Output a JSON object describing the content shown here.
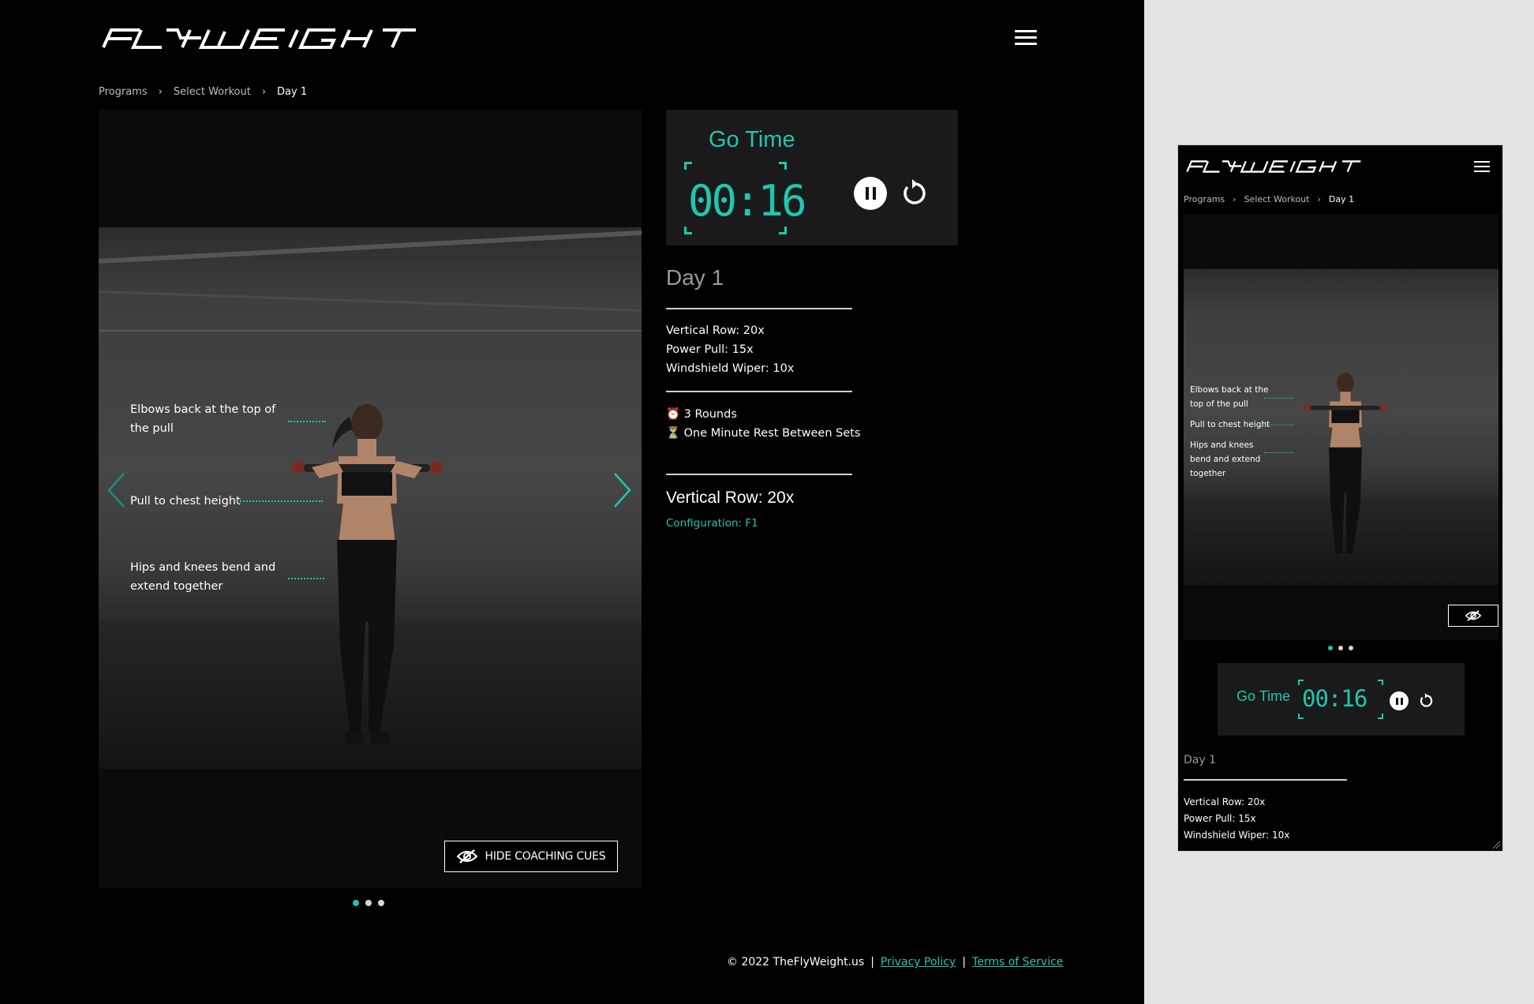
{
  "brand": {
    "logo_text": "FLYWEIGHT",
    "accent_color": "#20c6b0"
  },
  "breadcrumb": [
    "Programs",
    "Select Workout",
    "Day 1"
  ],
  "media": {
    "coaching_cues": [
      "Elbows back at the top of the pull",
      "Pull to chest height",
      "Hips and knees bend and extend together"
    ],
    "hide_cues_label": "HIDE COACHING CUES",
    "slide_count": 3,
    "active_slide": 1
  },
  "timer": {
    "label": "Go Time",
    "value": "00:16"
  },
  "workout": {
    "day_title": "Day 1",
    "exercises": [
      "Vertical Row: 20x",
      "Power Pull: 15x",
      "Windshield Wiper: 10x"
    ],
    "info": [
      {
        "icon": "⏰",
        "text": "3 Rounds"
      },
      {
        "icon": "⏳",
        "text": "One Minute Rest Between Sets"
      }
    ],
    "current_exercise": "Vertical Row: 20x",
    "configuration": "Configuration: F1"
  },
  "footer": {
    "copyright": "© 2022 TheFlyWeight.us",
    "separator": "|",
    "privacy": "Privacy Policy",
    "terms": "Terms of Service"
  },
  "mobile": {
    "coaching_cues": [
      "Elbows back at the top of the pull",
      "Pull to chest height",
      "Hips and knees bend and extend together"
    ]
  }
}
